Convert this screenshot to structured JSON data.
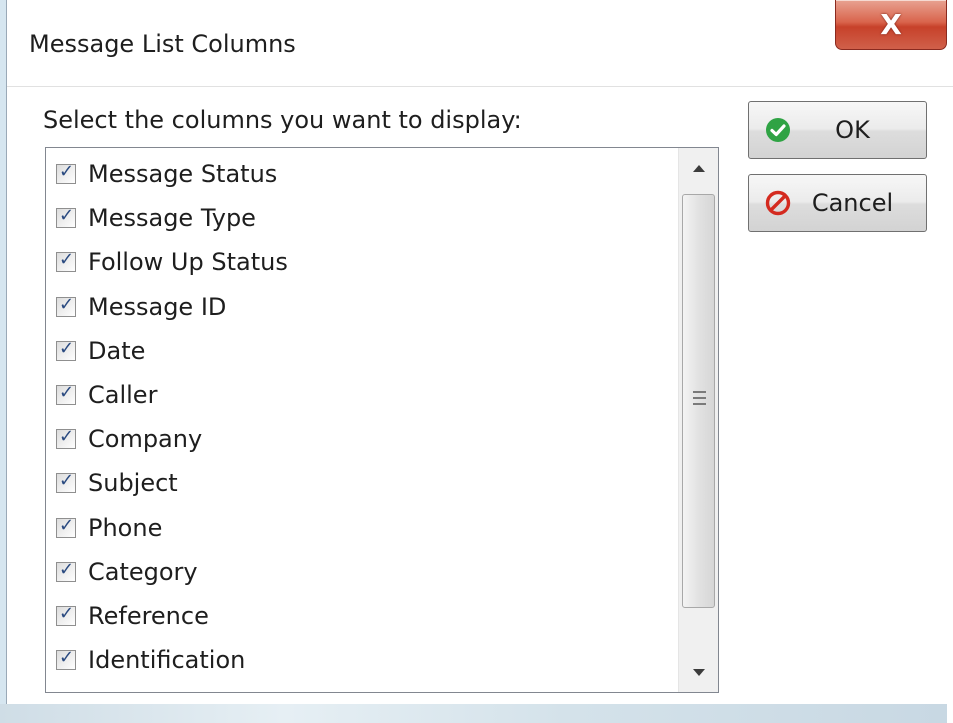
{
  "window": {
    "title": "Message List Columns",
    "close_label": "X"
  },
  "dialog": {
    "prompt": "Select the columns you want to display:"
  },
  "columns": [
    {
      "label": "Message Status",
      "checked": true
    },
    {
      "label": "Message Type",
      "checked": true
    },
    {
      "label": "Follow Up Status",
      "checked": true
    },
    {
      "label": "Message ID",
      "checked": true
    },
    {
      "label": "Date",
      "checked": true
    },
    {
      "label": "Caller",
      "checked": true
    },
    {
      "label": "Company",
      "checked": true
    },
    {
      "label": "Subject",
      "checked": true
    },
    {
      "label": "Phone",
      "checked": true
    },
    {
      "label": "Category",
      "checked": true
    },
    {
      "label": "Reference",
      "checked": true
    },
    {
      "label": "Identification",
      "checked": true
    }
  ],
  "buttons": {
    "ok": {
      "label": "OK",
      "icon": "check-circle-icon",
      "color": "#2fa344"
    },
    "cancel": {
      "label": "Cancel",
      "icon": "prohibited-icon",
      "color": "#d42a1f"
    }
  },
  "colors": {
    "close_button": "#c7412a",
    "checkmark": "#2a4a80"
  }
}
